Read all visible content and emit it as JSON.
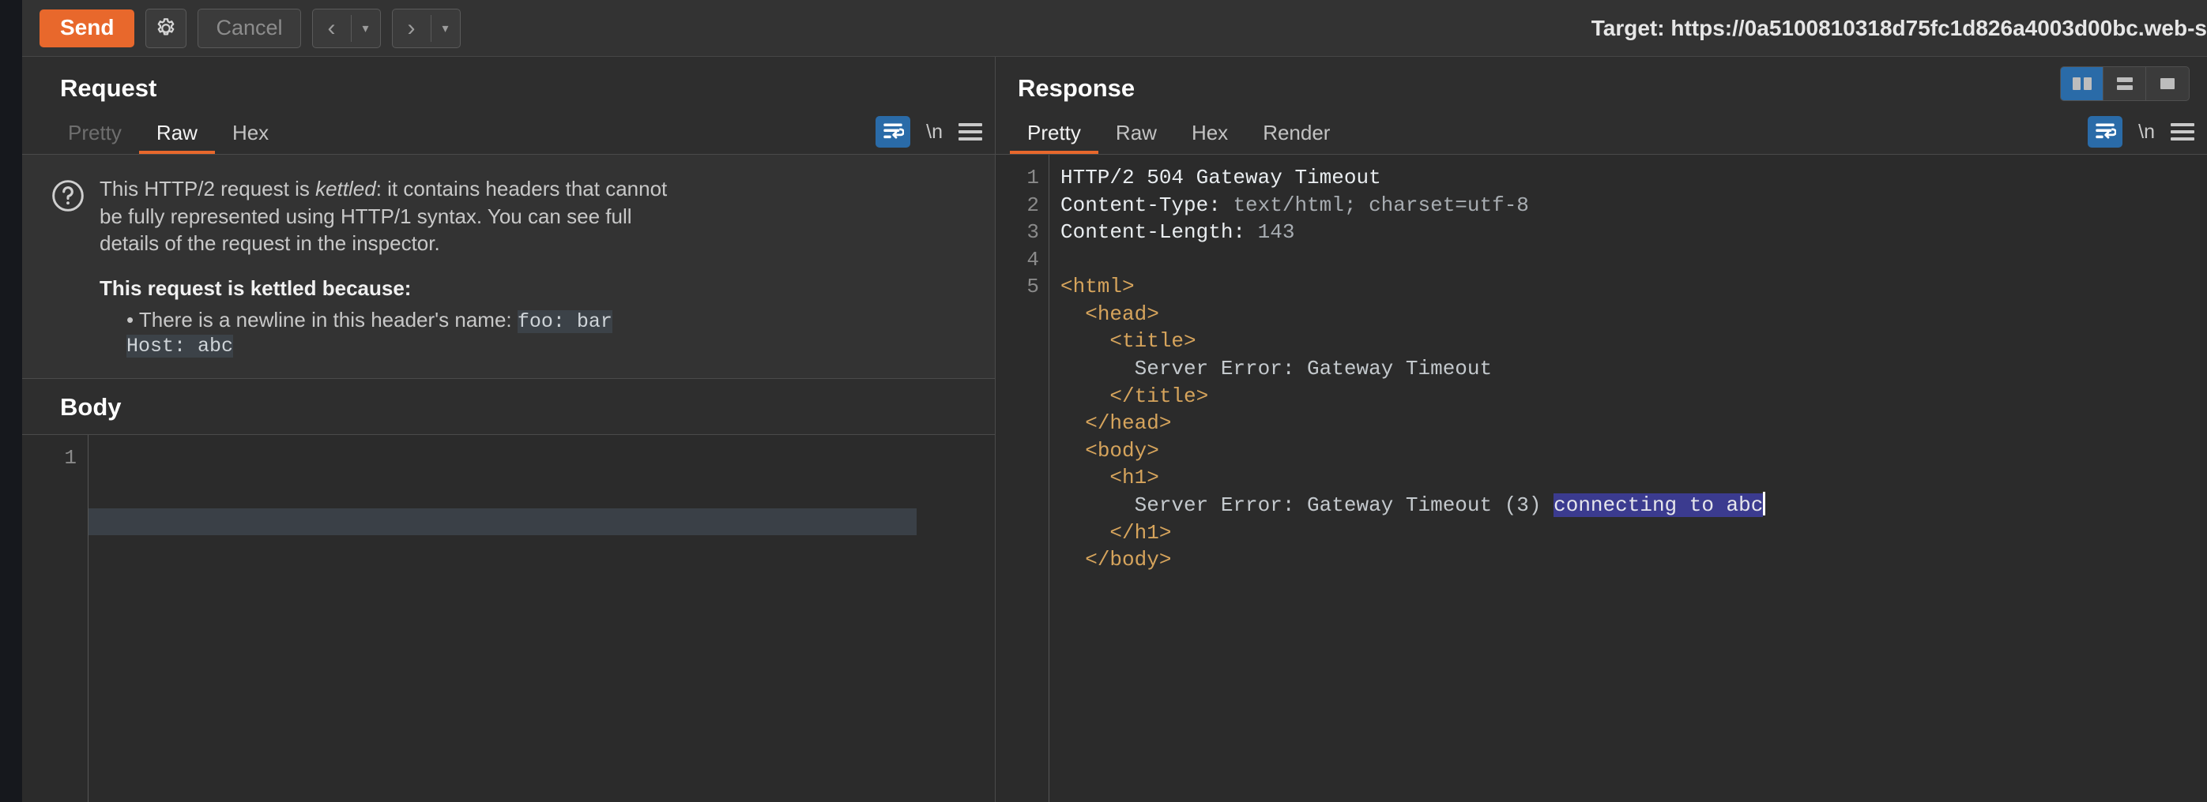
{
  "app": {
    "name": "Burp Suite Repeater",
    "accent_orange": "#e8682c",
    "accent_blue": "#2a6ba8",
    "selection_blue": "#3b3b8f",
    "tag_color": "#d6a45c"
  },
  "toolbar": {
    "send_label": "Send",
    "settings_icon": "gear-icon",
    "cancel_label": "Cancel",
    "back_icon": "chevron-left-icon",
    "forward_icon": "chevron-right-icon",
    "dropdown_caret": "▾",
    "target_label": "Target: https://0a5100810318d75fc1d826a4003d00bc.web-s"
  },
  "layout_toggle": {
    "options": [
      "side-by-side-layout",
      "stacked-layout",
      "single-pane-layout"
    ],
    "active": "side-by-side-layout"
  },
  "request": {
    "title": "Request",
    "tabs": [
      {
        "label": "Pretty",
        "state": "disabled"
      },
      {
        "label": "Raw",
        "state": "active"
      },
      {
        "label": "Hex",
        "state": "normal"
      }
    ],
    "tools": {
      "word_wrap_icon": "word-wrap-icon",
      "word_wrap_active": true,
      "newline_label": "\\n",
      "menu_icon": "hamburger-menu-icon"
    },
    "notice": {
      "icon": "question-circle-icon",
      "line1": "This HTTP/2 request is ",
      "emphasis": "kettled",
      "line1b": ": it contains headers that cannot",
      "line2": "be fully represented using HTTP/1 syntax. You can see full",
      "line3": "details of the request in the inspector.",
      "reason_heading": "This request is kettled because:",
      "bullet_prefix": "• There is a newline in this header's name: ",
      "bullet_mono": "foo: bar",
      "bullet_cont_mono": "Host: abc"
    },
    "body": {
      "title": "Body",
      "line_numbers": [
        "1"
      ],
      "lines": [
        ""
      ]
    }
  },
  "response": {
    "title": "Response",
    "tabs": [
      {
        "label": "Pretty",
        "state": "active"
      },
      {
        "label": "Raw",
        "state": "normal"
      },
      {
        "label": "Hex",
        "state": "normal"
      },
      {
        "label": "Render",
        "state": "normal"
      }
    ],
    "tools": {
      "word_wrap_icon": "word-wrap-icon",
      "word_wrap_active": true,
      "newline_label": "\\n",
      "menu_icon": "hamburger-menu-icon"
    },
    "line_numbers": [
      "1",
      "2",
      "3",
      "4",
      "5"
    ],
    "status_line": "HTTP/2 504 Gateway Timeout",
    "headers": [
      {
        "name": "Content-Type:",
        "value": " text/html; charset=utf-8"
      },
      {
        "name": "Content-Length:",
        "value": " 143"
      }
    ],
    "html_lines": [
      "<html>",
      "  <head>",
      "    <title>",
      "      Server Error: Gateway Timeout",
      "    </title>",
      "  </head>",
      "  <body>",
      "    <h1>",
      "      Server Error: Gateway Timeout (3) connecting to abc",
      "    </h1>",
      "  </body>"
    ],
    "selected_text": "connecting to abc",
    "h1_text_prefix": "      Server Error: Gateway Timeout (3) "
  }
}
